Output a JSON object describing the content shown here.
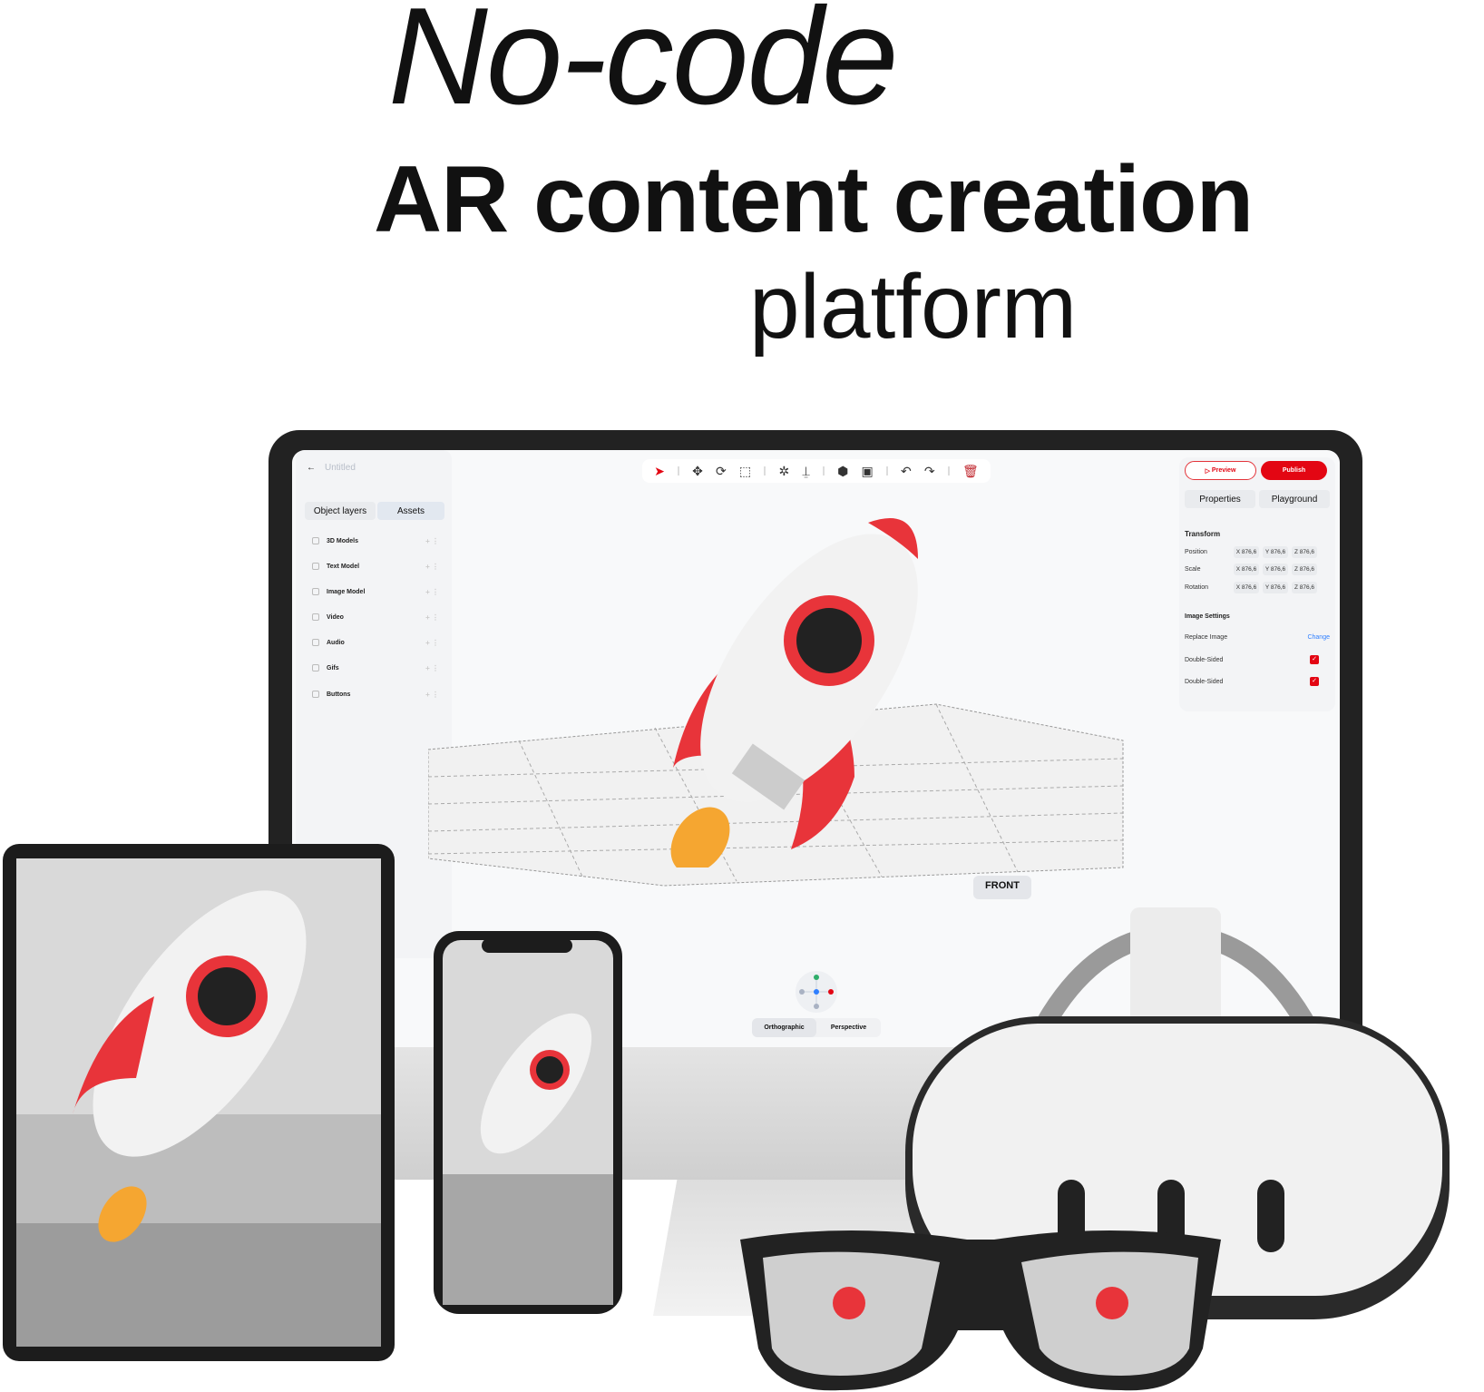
{
  "headline": {
    "line1": "No-code",
    "line2": "AR content creation",
    "line3": "platform"
  },
  "editor": {
    "project_title": "Untitled",
    "left_tabs": [
      "Object layers",
      "Assets"
    ],
    "asset_items": [
      "3D Models",
      "Text Model",
      "Image Model",
      "Video",
      "Audio",
      "Gifs",
      "Buttons"
    ],
    "toolbar_icons": [
      "select-icon",
      "move-icon",
      "rotate-icon",
      "scale-icon",
      "collapse-icon",
      "anchor-icon",
      "sphere-icon",
      "frame-icon",
      "undo-icon",
      "redo-icon",
      "trash-icon"
    ],
    "preview_label": "Preview",
    "publish_label": "Publish",
    "right_tabs": [
      "Properties",
      "Playground"
    ],
    "transform_title": "Transform",
    "transform_rows": [
      {
        "label": "Position",
        "x": "X 876,6",
        "y": "Y 876,6",
        "z": "Z 876,6"
      },
      {
        "label": "Scale",
        "x": "X 876,6",
        "y": "Y 876,6",
        "z": "Z 876,6"
      },
      {
        "label": "Rotation",
        "x": "X 876,6",
        "y": "Y 876,6",
        "z": "Z 876,6"
      }
    ],
    "image_settings_title": "Image Settings",
    "replace_image_label": "Replace Image",
    "change_label": "Change",
    "double_sided_1": "Double-Sided",
    "double_sided_2": "Double-Sided",
    "view_label": "FRONT",
    "projection_options": [
      "Orthographic",
      "Perspective"
    ],
    "accent": "#e30613"
  }
}
